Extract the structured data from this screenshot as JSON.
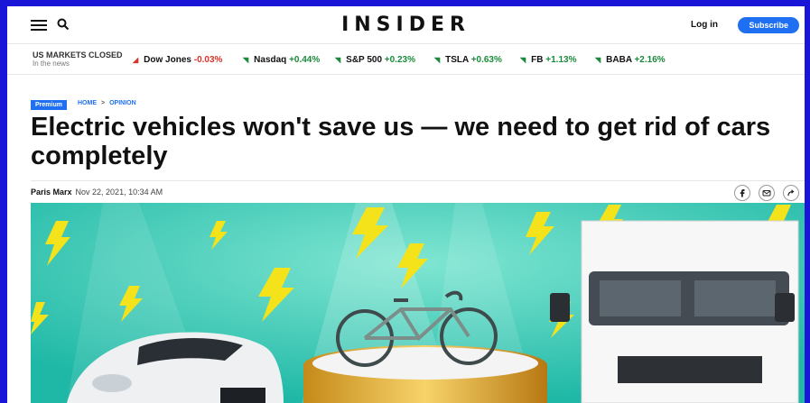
{
  "header": {
    "logo": "INSIDER",
    "login_label": "Log in",
    "subscribe_label": "Subscribe",
    "menu_icon": "hamburger-icon",
    "search_icon": "search-icon"
  },
  "markets": {
    "status_title": "US MARKETS CLOSED",
    "status_sub": "In the news",
    "tickers": [
      {
        "name": "Dow Jones",
        "change": "-0.03%",
        "direction": "down"
      },
      {
        "name": "Nasdaq",
        "change": "+0.44%",
        "direction": "up"
      },
      {
        "name": "S&P 500",
        "change": "+0.23%",
        "direction": "up"
      },
      {
        "name": "TSLA",
        "change": "+0.63%",
        "direction": "up"
      },
      {
        "name": "FB",
        "change": "+1.13%",
        "direction": "up"
      },
      {
        "name": "BABA",
        "change": "+2.16%",
        "direction": "up"
      }
    ]
  },
  "article": {
    "badge": "Premium",
    "breadcrumb": [
      "HOME",
      "OPINION"
    ],
    "breadcrumb_sep": ">",
    "headline": "Electric vehicles won't save us — we need to get rid of cars completely",
    "author": "Paris Marx",
    "date": "Nov 22, 2021, 10:34 AM",
    "share_icons": [
      "facebook-icon",
      "email-icon",
      "share-icon"
    ]
  },
  "colors": {
    "accent": "#1e6ff2",
    "down": "#d9322a",
    "up": "#1a8a3a",
    "hero_bg": "#38c9b3",
    "bolt": "#f4e21a"
  }
}
